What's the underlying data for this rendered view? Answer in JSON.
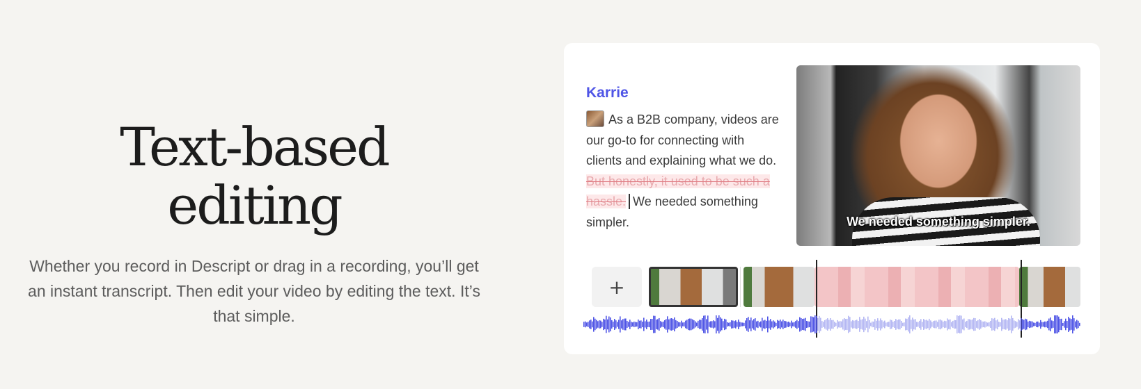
{
  "hero": {
    "title": "Text-based editing",
    "subtitle": "Whether you record in Descript or drag in a recording, you’ll get an instant transcript. Then edit your video by editing the text. It’s that simple."
  },
  "editor": {
    "speaker": "Karrie",
    "transcript": {
      "before": "As a B2B company, videos are our go-to for connecting with clients and explaining what we do.",
      "deleted": "But honestly, it used to be such a hassle.",
      "after": "We needed something simpler."
    },
    "video_caption": "We needed something simpler.",
    "add_clip_label": "+"
  },
  "colors": {
    "background": "#f5f4f1",
    "speaker": "#4f55e6",
    "deleted_text": "#e8a9ad",
    "waveform": "#4f55e6",
    "waveform_deleted": "#b4b7f3"
  }
}
